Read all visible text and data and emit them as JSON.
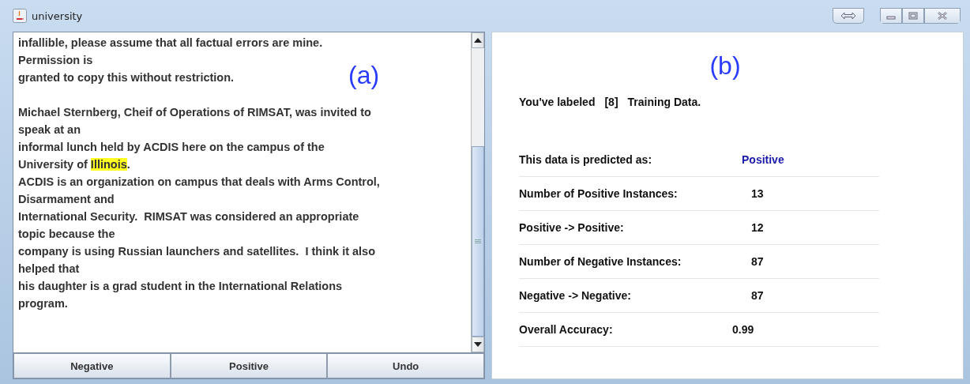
{
  "window": {
    "title": "university"
  },
  "document": {
    "paragraphs": [
      [
        [
          {
            "text": "infallible, please assume that all factual errors are mine.",
            "highlighted": false
          }
        ],
        [
          {
            "text": "Permission is",
            "highlighted": false
          }
        ],
        [
          {
            "text": "granted to copy this without restriction.",
            "highlighted": false
          }
        ]
      ],
      [
        [
          {
            "text": "Michael Sternberg, Cheif of Operations of RIMSAT, was invited to",
            "highlighted": false
          }
        ],
        [
          {
            "text": "speak at an",
            "highlighted": false
          }
        ],
        [
          {
            "text": "informal lunch held by ACDIS here on the campus of the",
            "highlighted": false
          }
        ],
        [
          {
            "text": "University of ",
            "highlighted": false
          },
          {
            "text": "Illinois",
            "highlighted": true
          },
          {
            "text": ".",
            "highlighted": false
          }
        ],
        [
          {
            "text": "ACDIS is an organization on campus that deals with Arms Control,",
            "highlighted": false
          }
        ],
        [
          {
            "text": "Disarmament and",
            "highlighted": false
          }
        ],
        [
          {
            "text": "International Security.  RIMSAT was considered an appropriate",
            "highlighted": false
          }
        ],
        [
          {
            "text": "topic because the",
            "highlighted": false
          }
        ],
        [
          {
            "text": "company is using Russian launchers and satellites.  I think it also",
            "highlighted": false
          }
        ],
        [
          {
            "text": "helped that",
            "highlighted": false
          }
        ],
        [
          {
            "text": "his daughter is a grad student in the International Relations",
            "highlighted": false
          }
        ],
        [
          {
            "text": "program.",
            "highlighted": false
          }
        ]
      ]
    ]
  },
  "panel_labels": [
    "(a)",
    "(b)"
  ],
  "buttons": [
    "Negative",
    "Positive",
    "Undo"
  ],
  "labeled": {
    "prefix": "You've labeled",
    "count": "[8]",
    "suffix": "Training Data."
  },
  "stats": [
    {
      "label": "This data is predicted as:",
      "value": "Positive",
      "kind": "prediction"
    },
    {
      "label": "Number of Positive Instances:",
      "value": "13",
      "kind": "count"
    },
    {
      "label": "Positive -> Positive:",
      "value": "12",
      "kind": "count"
    },
    {
      "label": "Number of Negative Instances:",
      "value": "87",
      "kind": "count"
    },
    {
      "label": "Negative -> Negative:",
      "value": "87",
      "kind": "count"
    },
    {
      "label": "Overall Accuracy:",
      "value": "0.99",
      "kind": "accuracy"
    }
  ]
}
